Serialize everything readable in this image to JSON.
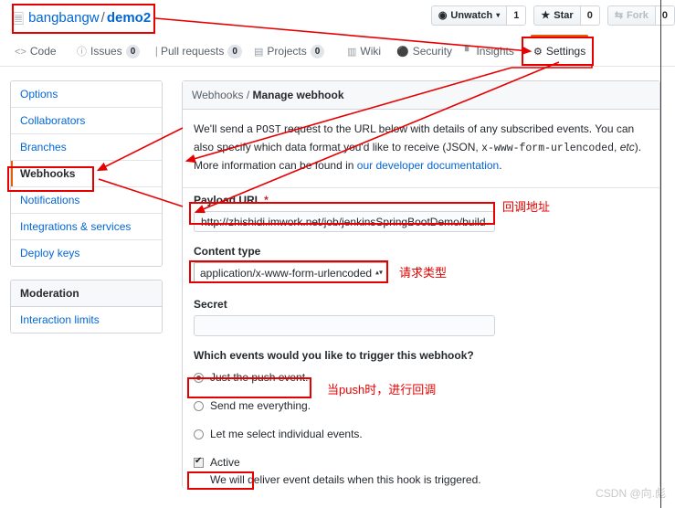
{
  "repo": {
    "icon": "repo-icon",
    "owner": "bangbangw",
    "separator": "/",
    "name": "demo2"
  },
  "header_actions": {
    "watch": {
      "icon": "eye-icon",
      "label": "Unwatch",
      "caret": "▾",
      "count": "1"
    },
    "star": {
      "icon": "star-icon",
      "label": "Star",
      "count": "0"
    },
    "fork": {
      "icon": "fork-icon",
      "label": "Fork",
      "count": "0"
    }
  },
  "nav_tabs": [
    {
      "icon": "code-icon",
      "glyph": "<>",
      "label": "Code",
      "count": null,
      "selected": false
    },
    {
      "icon": "issue-opened-icon",
      "glyph": "ⓘ",
      "label": "Issues",
      "count": "0",
      "selected": false
    },
    {
      "icon": "git-pull-request-icon",
      "glyph": "⑂",
      "label": "Pull requests",
      "count": "0",
      "selected": false
    },
    {
      "icon": "project-icon",
      "glyph": "▤",
      "label": "Projects",
      "count": "0",
      "selected": false
    },
    {
      "icon": "book-icon",
      "glyph": "▥",
      "label": "Wiki",
      "count": null,
      "selected": false
    },
    {
      "icon": "shield-icon",
      "glyph": "⛉",
      "label": "Security",
      "count": null,
      "selected": false
    },
    {
      "icon": "graph-icon",
      "glyph": "▐",
      "label": "Insights",
      "count": null,
      "selected": false
    },
    {
      "icon": "gear-icon",
      "glyph": "⚙",
      "label": "Settings",
      "count": null,
      "selected": true
    }
  ],
  "sidebar": {
    "items": [
      {
        "label": "Options",
        "selected": false
      },
      {
        "label": "Collaborators",
        "selected": false
      },
      {
        "label": "Branches",
        "selected": false
      },
      {
        "label": "Webhooks",
        "selected": true
      },
      {
        "label": "Notifications",
        "selected": false
      },
      {
        "label": "Integrations & services",
        "selected": false
      },
      {
        "label": "Deploy keys",
        "selected": false
      }
    ],
    "moderation_heading": "Moderation",
    "moderation_items": [
      {
        "label": "Interaction limits",
        "selected": false
      }
    ]
  },
  "main": {
    "breadcrumb_parent": "Webhooks",
    "breadcrumb_sep": " / ",
    "breadcrumb_current": "Manage webhook",
    "description": {
      "line1_a": "We'll send a ",
      "post": "POST",
      "line1_b": " request to the URL below with details of any subscribed events. You can also specify which data format you'd like to receive (JSON, ",
      "content_type_mono": "x-www-form-urlencoded",
      "line1_c": ", ",
      "etc": "etc",
      "line1_d": "). More information can be found in ",
      "link": "our developer documentation",
      "line1_e": "."
    },
    "payload_url": {
      "label": "Payload URL",
      "required_mark": "*",
      "value": "http://zhishidi.imwork.net/job/jenkinsSpringBootDemo/build"
    },
    "content_type": {
      "label": "Content type",
      "value": "application/x-www-form-urlencoded",
      "arrows": "▴▾"
    },
    "secret": {
      "label": "Secret",
      "value": "",
      "placeholder": ""
    },
    "events": {
      "question": "Which events would you like to trigger this webhook?",
      "options": [
        {
          "label": "Just the push event.",
          "checked": true
        },
        {
          "label": "Send me everything.",
          "checked": false
        },
        {
          "label": "Let me select individual events.",
          "checked": false
        }
      ]
    },
    "active": {
      "label": "Active",
      "checked": true,
      "description": "We will deliver event details when this hook is triggered."
    }
  },
  "annotations": {
    "color": "#e60000",
    "callback_address": "回调地址",
    "request_type": "请求类型",
    "push_callback": "当push时，进行回调"
  },
  "watermark": "CSDN @向.彪"
}
